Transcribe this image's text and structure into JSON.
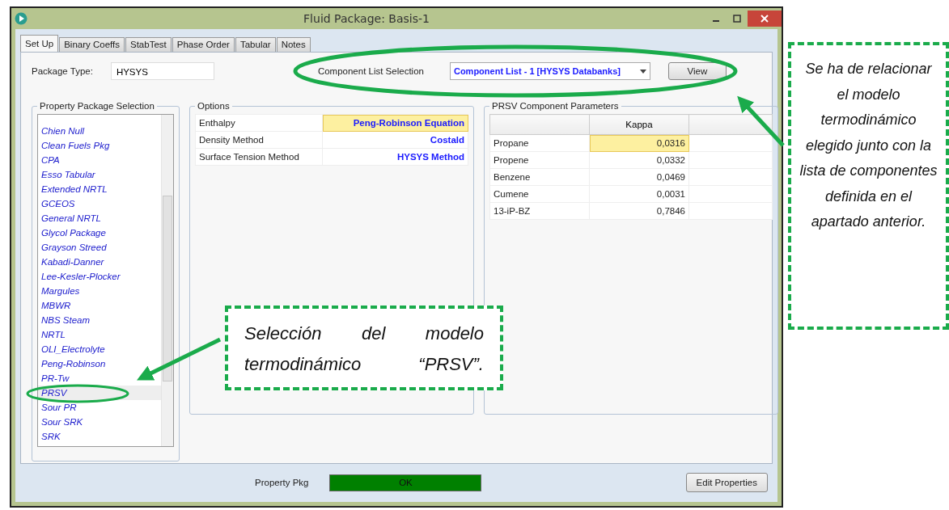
{
  "window": {
    "title": "Fluid Package: Basis-1"
  },
  "tabs": [
    {
      "label": "Set Up",
      "selected": true
    },
    {
      "label": "Binary Coeffs",
      "selected": false
    },
    {
      "label": "StabTest",
      "selected": false
    },
    {
      "label": "Phase Order",
      "selected": false
    },
    {
      "label": "Tabular",
      "selected": false
    },
    {
      "label": "Notes",
      "selected": false
    }
  ],
  "package_type": {
    "label": "Package Type:",
    "value": "HYSYS"
  },
  "component_list": {
    "label": "Component List Selection",
    "value": "Component List - 1 [HYSYS Databanks]",
    "button": "View"
  },
  "property_package_selection": {
    "title": "Property Package Selection",
    "items": [
      {
        "label": "Chien Null",
        "selected": false
      },
      {
        "label": "Clean Fuels Pkg",
        "selected": false
      },
      {
        "label": "CPA",
        "selected": false
      },
      {
        "label": "Esso Tabular",
        "selected": false
      },
      {
        "label": "Extended NRTL",
        "selected": false
      },
      {
        "label": "GCEOS",
        "selected": false
      },
      {
        "label": "General NRTL",
        "selected": false
      },
      {
        "label": "Glycol Package",
        "selected": false
      },
      {
        "label": "Grayson Streed",
        "selected": false
      },
      {
        "label": "Kabadi-Danner",
        "selected": false
      },
      {
        "label": "Lee-Kesler-Plocker",
        "selected": false
      },
      {
        "label": "Margules",
        "selected": false
      },
      {
        "label": "MBWR",
        "selected": false
      },
      {
        "label": "NBS Steam",
        "selected": false
      },
      {
        "label": "NRTL",
        "selected": false
      },
      {
        "label": "OLI_Electrolyte",
        "selected": false
      },
      {
        "label": "Peng-Robinson",
        "selected": false
      },
      {
        "label": "PR-Tw",
        "selected": false
      },
      {
        "label": "PRSV",
        "selected": true
      },
      {
        "label": "Sour PR",
        "selected": false
      },
      {
        "label": "Sour SRK",
        "selected": false
      },
      {
        "label": "SRK",
        "selected": false
      }
    ]
  },
  "options": {
    "title": "Options",
    "rows": [
      {
        "name": "Enthalpy",
        "value": "Peng-Robinson Equation",
        "selected": true
      },
      {
        "name": "Density Method",
        "value": "Costald",
        "selected": false
      },
      {
        "name": "Surface Tension Method",
        "value": "HYSYS Method",
        "selected": false
      }
    ]
  },
  "prsv_parameters": {
    "title": "PRSV Component Parameters",
    "columns": [
      "Kappa"
    ],
    "rows": [
      {
        "name": "Propane",
        "kappa": "0,0316",
        "selected": true
      },
      {
        "name": "Propene",
        "kappa": "0,0332",
        "selected": false
      },
      {
        "name": "Benzene",
        "kappa": "0,0469",
        "selected": false
      },
      {
        "name": "Cumene",
        "kappa": "0,0031",
        "selected": false
      },
      {
        "name": "13-iP-BZ",
        "kappa": "0,7846",
        "selected": false
      }
    ]
  },
  "status_bar": {
    "label": "Property Pkg",
    "status": "OK",
    "button": "Edit Properties"
  },
  "annotations": [
    {
      "kind": "left",
      "text": "Selección del modelo termodinámico “PRSV”."
    },
    {
      "kind": "right",
      "text": "Se ha de relacionar el modelo termodinámico elegido junto con la lista de componentes definida en el apartado anterior."
    }
  ]
}
